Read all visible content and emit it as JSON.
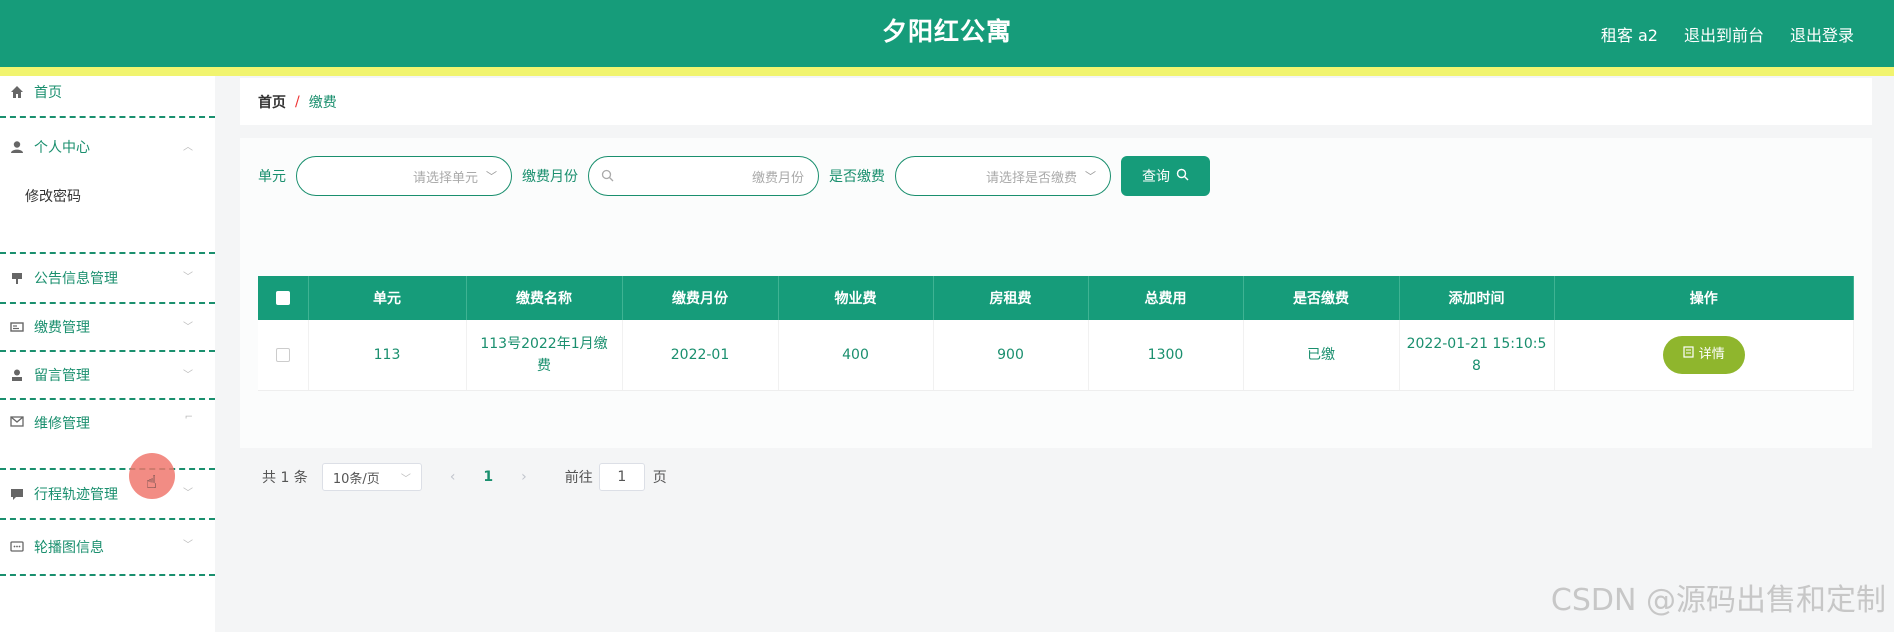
{
  "app": {
    "title": "夕阳红公寓"
  },
  "header_links": {
    "user": "租客 a2",
    "to_front": "退出到前台",
    "logout": "退出登录"
  },
  "sidebar": {
    "items": [
      {
        "label": "首页",
        "icon": "home-icon"
      },
      {
        "label": "个人中心",
        "icon": "user-icon",
        "expanded": true,
        "children": [
          "修改密码"
        ]
      },
      {
        "label": "公告信息管理",
        "icon": "notice-icon"
      },
      {
        "label": "缴费管理",
        "icon": "payment-icon"
      },
      {
        "label": "留言管理",
        "icon": "message-user-icon"
      },
      {
        "label": "维修管理",
        "icon": "mail-icon"
      },
      {
        "label": "行程轨迹管理",
        "icon": "chat-icon"
      },
      {
        "label": "轮播图信息",
        "icon": "comment-icon"
      }
    ]
  },
  "breadcrumb": {
    "home": "首页",
    "separator": "/",
    "current": "缴费"
  },
  "search": {
    "unit_label": "单元",
    "unit_placeholder": "请选择单元",
    "month_label": "缴费月份",
    "month_placeholder": "缴费月份",
    "paid_label": "是否缴费",
    "paid_placeholder": "请选择是否缴费",
    "query_button": "查询"
  },
  "table": {
    "headers": [
      "单元",
      "缴费名称",
      "缴费月份",
      "物业费",
      "房租费",
      "总费用",
      "是否缴费",
      "添加时间",
      "操作"
    ],
    "rows": [
      {
        "unit": "113",
        "name_line1": "113号2022年1月缴",
        "name_line2": "费",
        "month": "2022-01",
        "property_fee": "400",
        "rent_fee": "900",
        "total": "1300",
        "paid": "已缴",
        "time_line1": "2022-01-21 15:10:5",
        "time_line2": "8",
        "action": "详情"
      }
    ]
  },
  "pagination": {
    "total_text": "共 1 条",
    "page_size": "10条/页",
    "current_page": "1",
    "goto_label": "前往",
    "goto_value": "1",
    "page_suffix": "页"
  },
  "watermark": "CSDN @源码出售和定制",
  "colors": {
    "primary": "#169c7a",
    "accent_bar": "#f1f46f",
    "detail_button": "#8fb62d"
  }
}
